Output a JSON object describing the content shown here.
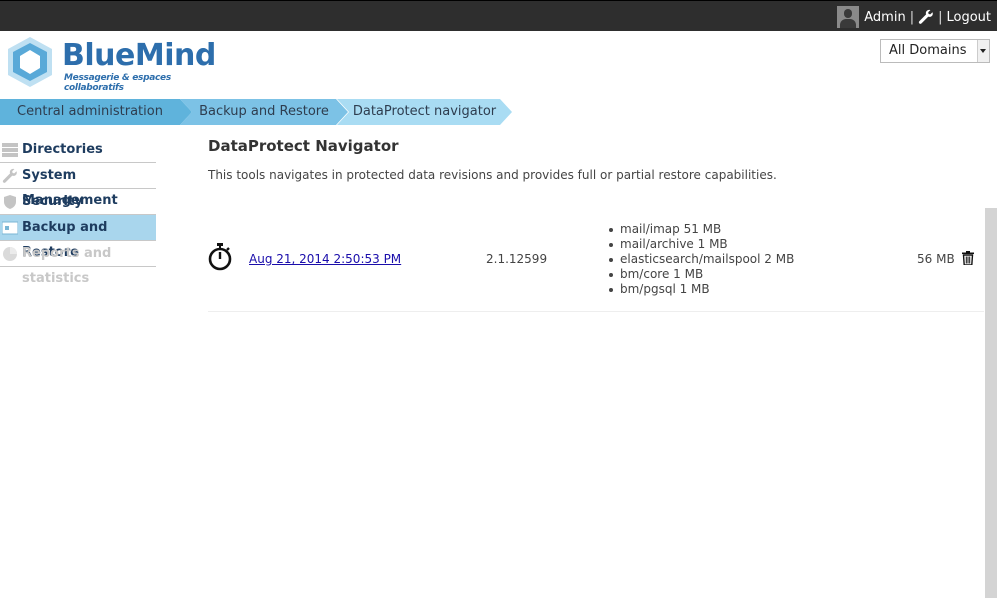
{
  "topbar": {
    "user": "Admin",
    "sep1": "|",
    "sep2": "|",
    "logout": "Logout"
  },
  "logo": {
    "brand": "BlueMind",
    "tagline": "Messagerie & espaces collaboratifs"
  },
  "domain_select": {
    "value": "All Domains"
  },
  "breadcrumb": [
    {
      "label": "Central administration"
    },
    {
      "label": "Backup and Restore"
    },
    {
      "label": "DataProtect navigator"
    }
  ],
  "sidebar": {
    "items": [
      {
        "label": "Directories",
        "icon": "directory-icon",
        "state": "normal"
      },
      {
        "label": "System Management",
        "icon": "wrench-icon",
        "state": "normal"
      },
      {
        "label": "Security",
        "icon": "shield-icon",
        "state": "normal"
      },
      {
        "label": "Backup and Restore",
        "icon": "backup-icon",
        "state": "active"
      },
      {
        "label": "Reports and statistics",
        "icon": "chart-icon",
        "state": "disabled"
      }
    ]
  },
  "main": {
    "title": "DataProtect Navigator",
    "description": "This tools navigates in protected data revisions and provides full or partial restore capabilities.",
    "rows": [
      {
        "date": "Aug 21, 2014 2:50:53 PM",
        "version": "2.1.12599",
        "parts": [
          "mail/imap 51 MB",
          "mail/archive 1 MB",
          "elasticsearch/mailspool 2 MB",
          "bm/core 1 MB",
          "bm/pgsql 1 MB"
        ],
        "size": "56 MB"
      }
    ]
  },
  "colors": {
    "topbar": "#2e2e2e",
    "brand": "#2d6eac",
    "crumb_dark": "#5fb3dc",
    "crumb_light": "#a9dcf3",
    "sidebar_active": "#a9d6ed"
  }
}
